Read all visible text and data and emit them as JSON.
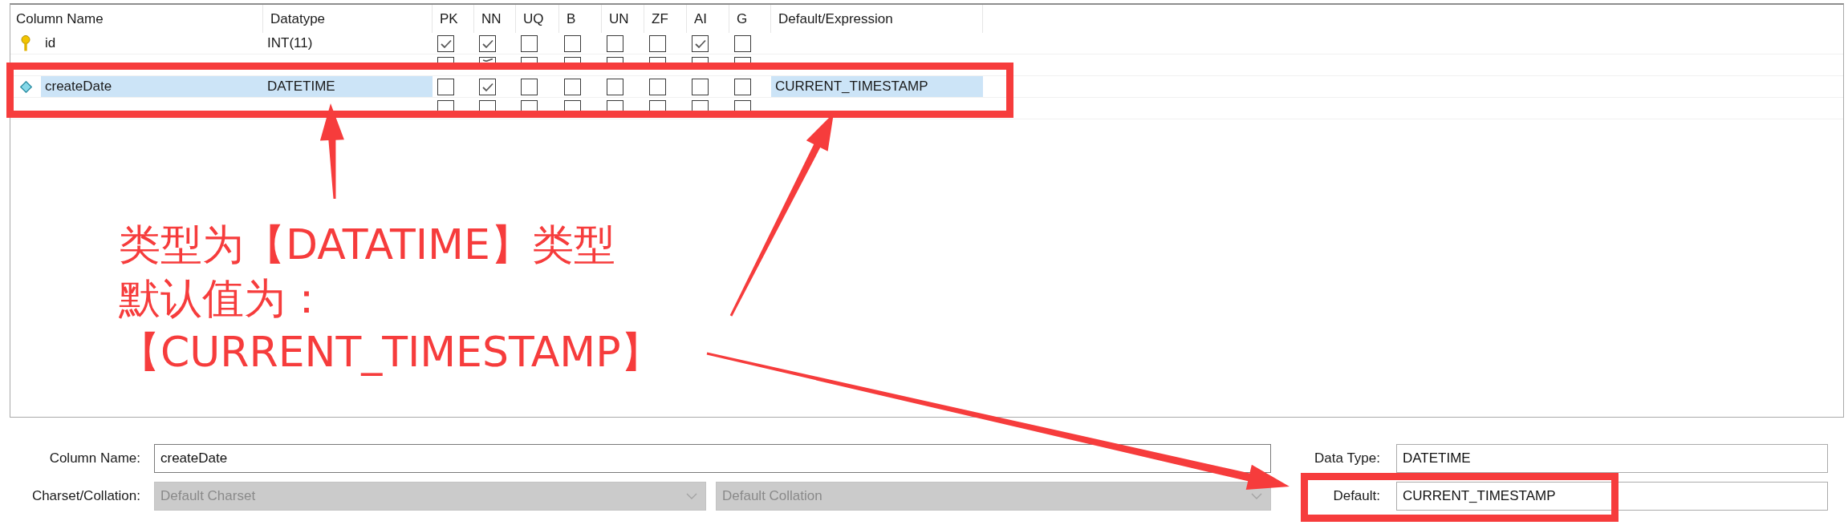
{
  "table": {
    "columns": [
      {
        "label": "Column Name"
      },
      {
        "label": "Datatype"
      },
      {
        "label": "PK"
      },
      {
        "label": "NN"
      },
      {
        "label": "UQ"
      },
      {
        "label": "B"
      },
      {
        "label": "UN"
      },
      {
        "label": "ZF"
      },
      {
        "label": "AI"
      },
      {
        "label": "G"
      },
      {
        "label": "Default/Expression"
      }
    ],
    "rows": [
      {
        "name": "id",
        "datatype": "INT(11)",
        "flags": [
          {
            "checked": true
          },
          {
            "checked": true
          },
          {
            "checked": false
          },
          {
            "checked": false
          },
          {
            "checked": false
          },
          {
            "checked": false
          },
          {
            "checked": true
          },
          {
            "checked": false
          }
        ],
        "selected": false
      },
      {
        "flags": [
          {
            "checked": false
          },
          {
            "checked": true
          },
          {
            "checked": false
          },
          {
            "checked": false
          },
          {
            "checked": false
          },
          {
            "checked": false
          },
          {
            "checked": false
          },
          {
            "checked": false
          }
        ],
        "selected": false
      },
      {
        "name": "createDate",
        "datatype": "DATETIME",
        "flags": [
          {
            "checked": false
          },
          {
            "checked": true
          },
          {
            "checked": false
          },
          {
            "checked": false
          },
          {
            "checked": false
          },
          {
            "checked": false
          },
          {
            "checked": false
          },
          {
            "checked": false
          }
        ],
        "default": "CURRENT_TIMESTAMP",
        "selected": true
      },
      {
        "flags": [
          {
            "checked": false
          },
          {
            "checked": false
          },
          {
            "checked": false
          },
          {
            "checked": false
          },
          {
            "checked": false
          },
          {
            "checked": false
          },
          {
            "checked": false
          },
          {
            "checked": false
          }
        ],
        "selected": false
      }
    ]
  },
  "annotation": {
    "lines": [
      "类型为【DATATIME】类型",
      "默认值为：",
      "【CURRENT_TIMESTAMP】"
    ]
  },
  "details": {
    "column_name": {
      "label": "Column Name:",
      "value": "createDate"
    },
    "charset_collation": {
      "label": "Charset/Collation:",
      "charset": {
        "value": "Default Charset",
        "disabled": true
      },
      "collation": {
        "value": "Default Collation",
        "disabled": true
      }
    },
    "data_type": {
      "label": "Data Type:",
      "value": "DATETIME"
    },
    "default": {
      "label": "Default:",
      "value": "CURRENT_TIMESTAMP"
    }
  }
}
